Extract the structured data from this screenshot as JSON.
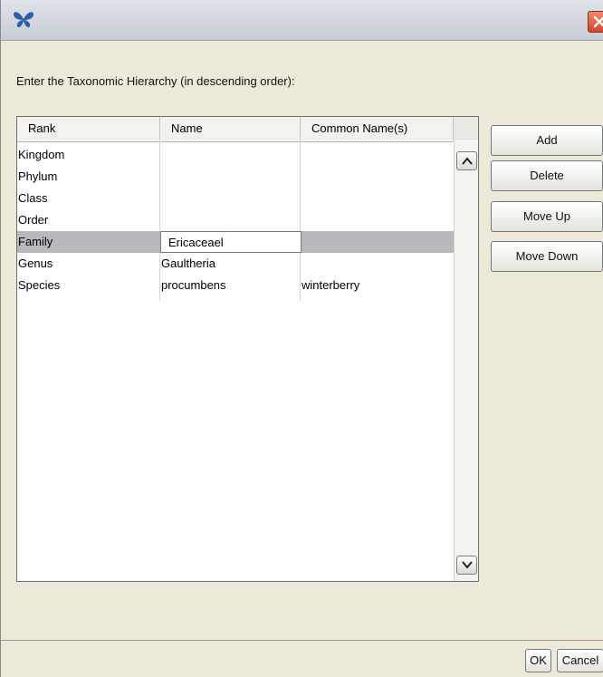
{
  "window": {
    "title": ""
  },
  "instruction": "Enter the Taxonomic Hierarchy (in descending order):",
  "table": {
    "columns": [
      "Rank",
      "Name",
      "Common Name(s)"
    ],
    "rows": [
      {
        "rank": "Kingdom",
        "name": "",
        "common": ""
      },
      {
        "rank": "Phylum",
        "name": "",
        "common": ""
      },
      {
        "rank": "Class",
        "name": "",
        "common": ""
      },
      {
        "rank": "Order",
        "name": "",
        "common": ""
      },
      {
        "rank": "Family",
        "name": "",
        "common": ""
      },
      {
        "rank": "Genus",
        "name": "Gaultheria",
        "common": ""
      },
      {
        "rank": "Species",
        "name": "procumbens",
        "common": "winterberry"
      }
    ],
    "selected_row": "Family",
    "editing_value": "Ericaceael"
  },
  "buttons": {
    "add": "Add",
    "delete": "Delete",
    "move_up": "Move Up",
    "move_down": "Move Down",
    "ok": "OK",
    "cancel": "Cancel"
  },
  "icons": {
    "app": "butterfly-icon",
    "close": "close-icon",
    "scroll_up": "arrow-up-icon",
    "scroll_down": "arrow-down-icon"
  },
  "colors": {
    "selected_row": "#b8b8bd",
    "close_button": "#d2452a",
    "app_icon": "#2a5fb0"
  }
}
